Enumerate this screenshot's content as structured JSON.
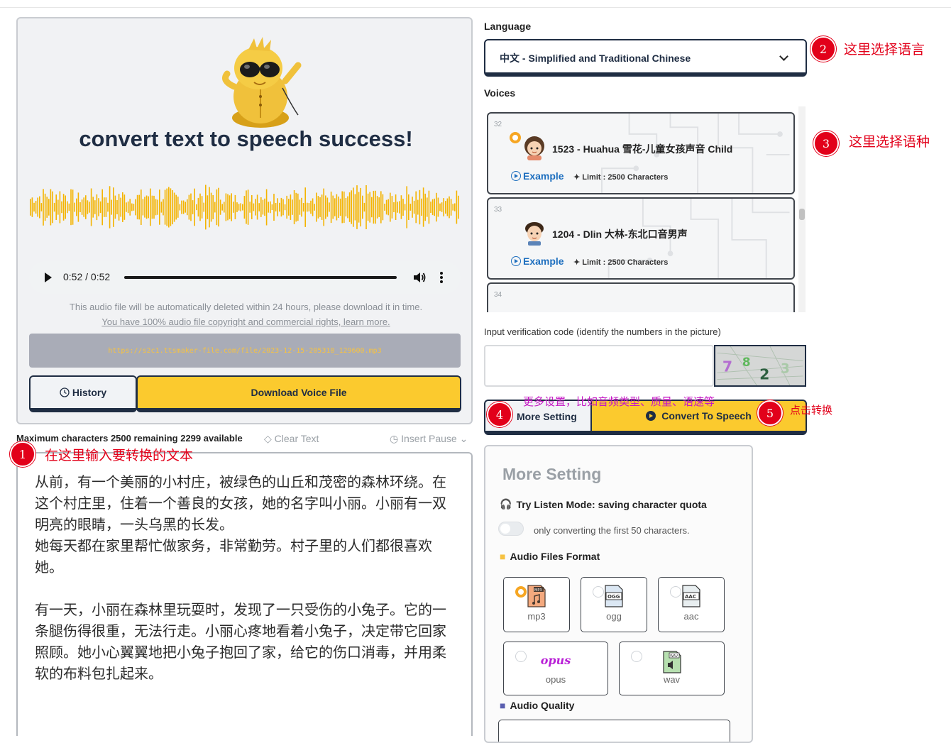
{
  "result": {
    "title": "convert text to speech success!",
    "player": {
      "time": "0:52 / 0:52",
      "progress": 1.0
    },
    "note": "This audio file will be automatically deleted within 24 hours, please download it in time.",
    "copyright_link": "You have 100% audio file copyright and commercial rights, learn more.",
    "url": "https://s2c1.ttsmaker-file.com/file/2023-12-15-205310_129600.mp3",
    "history_label": "History",
    "download_label": "Download Voice File"
  },
  "editor": {
    "chars_label": "Maximum characters 2500 remaining 2299 available",
    "clear_label": "Clear Text",
    "insert_pause_label": "Insert Pause",
    "text": "从前，有一个美丽的小村庄，被绿色的山丘和茂密的森林环绕。在这个村庄里，住着一个善良的女孩，她的名字叫小丽。小丽有一双明亮的眼睛，一头乌黑的长发。\n她每天都在家里帮忙做家务，非常勤劳。村子里的人们都很喜欢她。\n\n有一天，小丽在森林里玩耍时，发现了一只受伤的小兔子。它的一条腿伤得很重，无法行走。小丽心疼地看着小兔子，决定带它回家照顾。她小心翼翼地把小兔子抱回了家，给它的伤口消毒，并用柔软的布料包扎起来。"
  },
  "language": {
    "label": "Language",
    "selected": "中文 - Simplified and Traditional Chinese"
  },
  "voices": {
    "label": "Voices",
    "items": [
      {
        "num": "32",
        "name": "1523 - Huahua 雪花-儿童女孩声音 Child",
        "example": "Example",
        "limit": "Limit : 2500 Characters",
        "selected": true
      },
      {
        "num": "33",
        "name": "1204 - Dlin 大林-东北口音男声",
        "example": "Example",
        "limit": "Limit : 2500 Characters",
        "selected": false
      },
      {
        "num": "34"
      }
    ]
  },
  "verification": {
    "label": "Input verification code (identify the numbers in the picture)",
    "value": "",
    "captcha": [
      "7",
      "8",
      "2",
      "3"
    ]
  },
  "actions": {
    "more_setting_label": "More Setting",
    "convert_label": "Convert To Speech"
  },
  "settings": {
    "title": "More Setting",
    "try_listen_label": "Try Listen Mode: saving character quota",
    "try_listen_desc": "only converting the first 50 characters.",
    "format_label": "Audio Files Format",
    "formats": [
      {
        "label": "mp3",
        "tag": "MP3",
        "selected": true
      },
      {
        "label": "ogg",
        "tag": "OGG",
        "selected": false
      },
      {
        "label": "aac",
        "tag": "AAC",
        "selected": false
      },
      {
        "label": "opus",
        "tag": "opus",
        "selected": false
      },
      {
        "label": "wav",
        "tag": "WAV",
        "selected": false
      }
    ],
    "quality_label": "Audio Quality"
  },
  "annotations": {
    "a1": {
      "num": "1",
      "text": "在这里输入要转换的文本"
    },
    "a2": {
      "num": "2",
      "text": "这里选择语言"
    },
    "a3": {
      "num": "3",
      "text": "这里选择语种"
    },
    "a4": {
      "num": "4",
      "text": "更多设置，比如音频类型、质量、语速等"
    },
    "a5": {
      "num": "5",
      "text": "点击转换"
    }
  },
  "colors": {
    "accent": "#fbca2e",
    "dark": "#1f2d43",
    "annotation": "#e2001a",
    "link": "#1e6fbf"
  }
}
